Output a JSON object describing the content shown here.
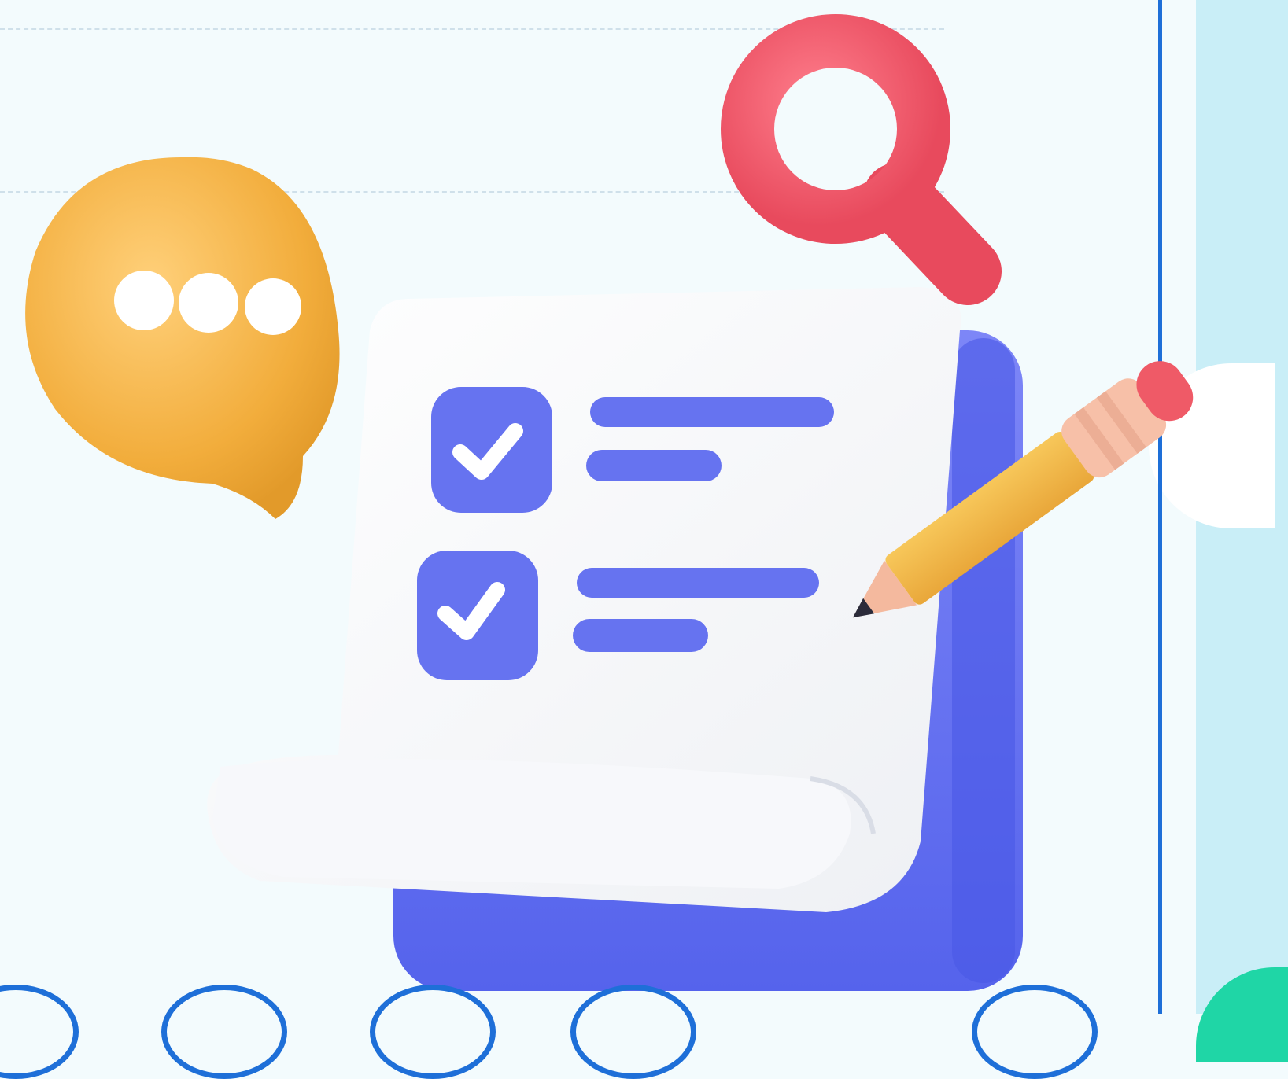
{
  "illustration": {
    "subject": "checklist-document",
    "checklist_items": [
      {
        "checked": true
      },
      {
        "checked": true
      }
    ],
    "decorations": [
      "chat-bubble-icon",
      "magnifier-icon",
      "pencil-icon"
    ]
  },
  "colors": {
    "page_background": "#f3fbfd",
    "side_panel": "#c9eef7",
    "side_wave": "#1fd6a6",
    "frame_border": "#1e6fd8",
    "accent_blue": "#6673f0",
    "accent_yellow": "#f2ad3c",
    "accent_red": "#f0566a",
    "pencil_tip": "#f4b99e"
  }
}
